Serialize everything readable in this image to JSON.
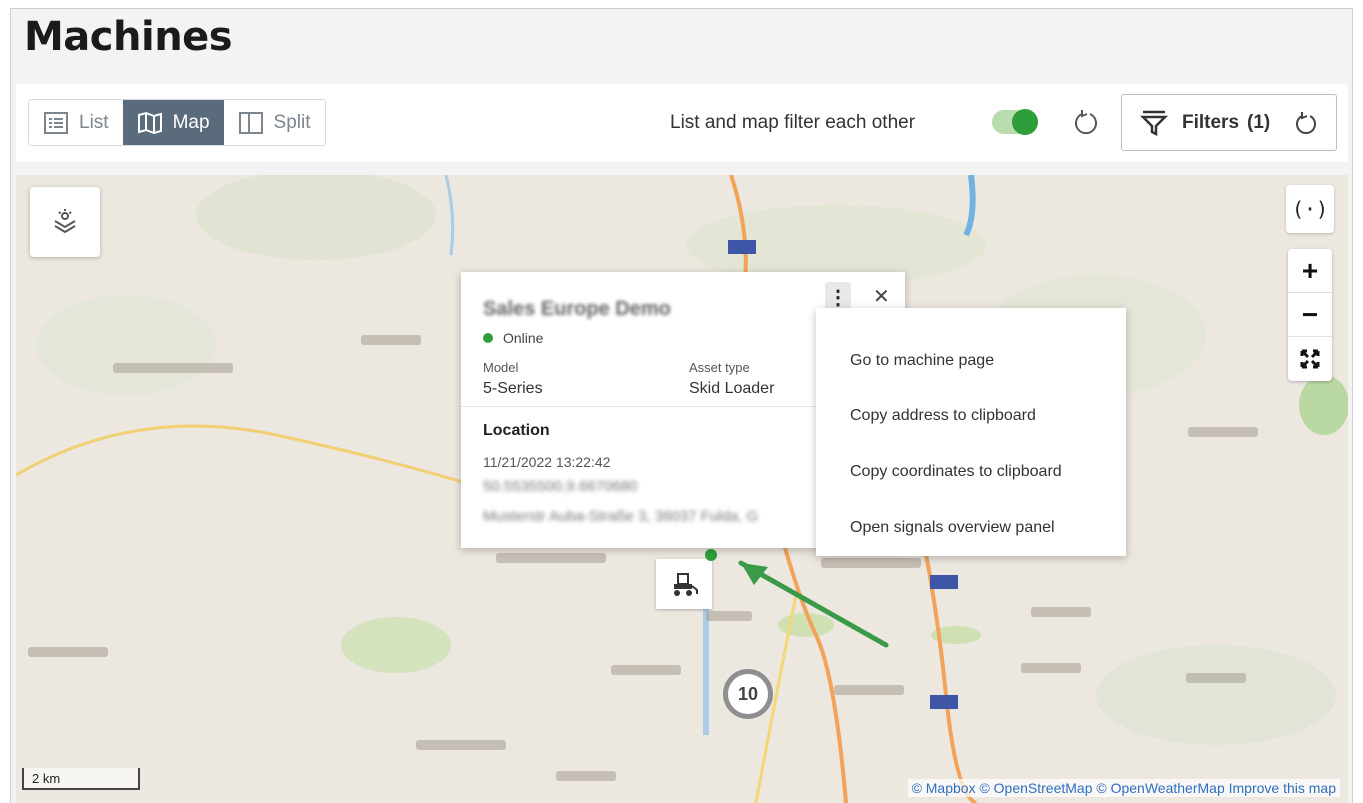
{
  "page": {
    "title": "Machines"
  },
  "toolbar": {
    "views": [
      {
        "label": "List",
        "icon": "list-icon",
        "active": false
      },
      {
        "label": "Map",
        "icon": "map-icon",
        "active": true
      },
      {
        "label": "Split",
        "icon": "split-icon",
        "active": false
      }
    ],
    "sync_label": "List and map filter each other",
    "sync_enabled": true,
    "filters_label": "Filters",
    "filters_count": "(1)"
  },
  "map": {
    "cluster_count": "10",
    "scale_label": "2 km",
    "attribution": "© Mapbox © OpenStreetMap © OpenWeatherMap Improve this map",
    "controls": {
      "locate": "(·)",
      "zoom_in": "+",
      "zoom_out": "−",
      "fullscreen": "fullscreen-icon"
    }
  },
  "popup": {
    "machine_name": "Sales Europe Demo",
    "status": "Online",
    "status_color": "#2e9e3b",
    "model_label": "Model",
    "model_value": "5-Series",
    "asset_type_label": "Asset type",
    "asset_type_value": "Skid Loader",
    "location_label": "Location",
    "timestamp": "11/21/2022 13:22:42",
    "coordinates": "50.5535500,9.6670680",
    "address": "Musterstr Auba-Straße 3, 36037 Fulda, G"
  },
  "context_menu": {
    "items": [
      "Go to machine page",
      "Copy address to clipboard",
      "Copy coordinates to clipboard",
      "Open signals overview panel"
    ]
  },
  "colors": {
    "accent_active": "#5a6b7c",
    "toggle_green": "#2e9e3b",
    "annotation_arrow": "#3a9a48"
  }
}
